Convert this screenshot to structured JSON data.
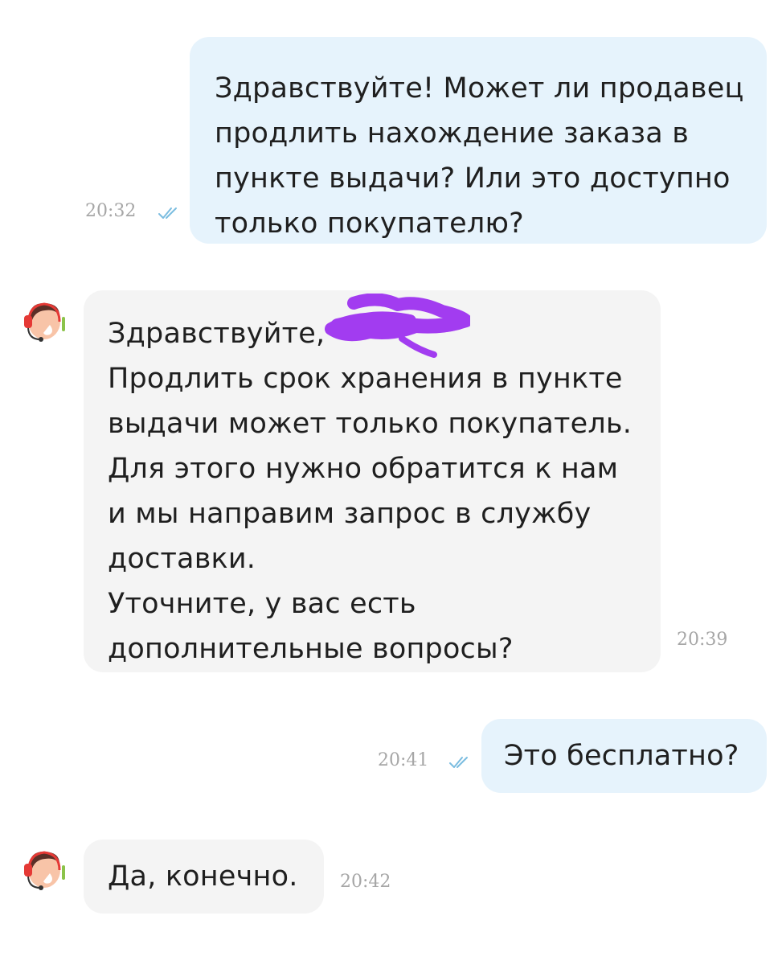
{
  "messages": [
    {
      "direction": "out",
      "lines": [
        "Здравствуйте! Может ли продавец",
        "продлить нахождение заказа в",
        "пункте выдачи? Или это доступно",
        "только покупателю?"
      ],
      "time": "20:32",
      "status": "read"
    },
    {
      "direction": "in",
      "lines": [
        "Здравствуйте,",
        "Продлить срок хранения в пункте",
        "выдачи может только покупатель.",
        "Для этого нужно обратится к нам",
        "и мы направим запрос в службу",
        "доставки.",
        "Уточните, у вас есть",
        "дополнительные вопросы?"
      ],
      "time": "20:39",
      "redacted": true
    },
    {
      "direction": "out",
      "lines": [
        "Это бесплатно?"
      ],
      "time": "20:41",
      "status": "read"
    },
    {
      "direction": "in",
      "lines": [
        "Да, конечно."
      ],
      "time": "20:42"
    }
  ],
  "icons": {
    "avatar": "support-agent-headset-avatar",
    "read_status": "double-check-icon",
    "redaction": "purple-scribble"
  },
  "colors": {
    "outgoing_bubble": "#e6f3fc",
    "incoming_bubble": "#f4f4f4",
    "tick": "#7bbde0",
    "time_text": "#a6a6a6",
    "redaction": "#a23cf0",
    "avatar_headset": "#e53935",
    "avatar_mic_accent": "#8bc34a"
  }
}
